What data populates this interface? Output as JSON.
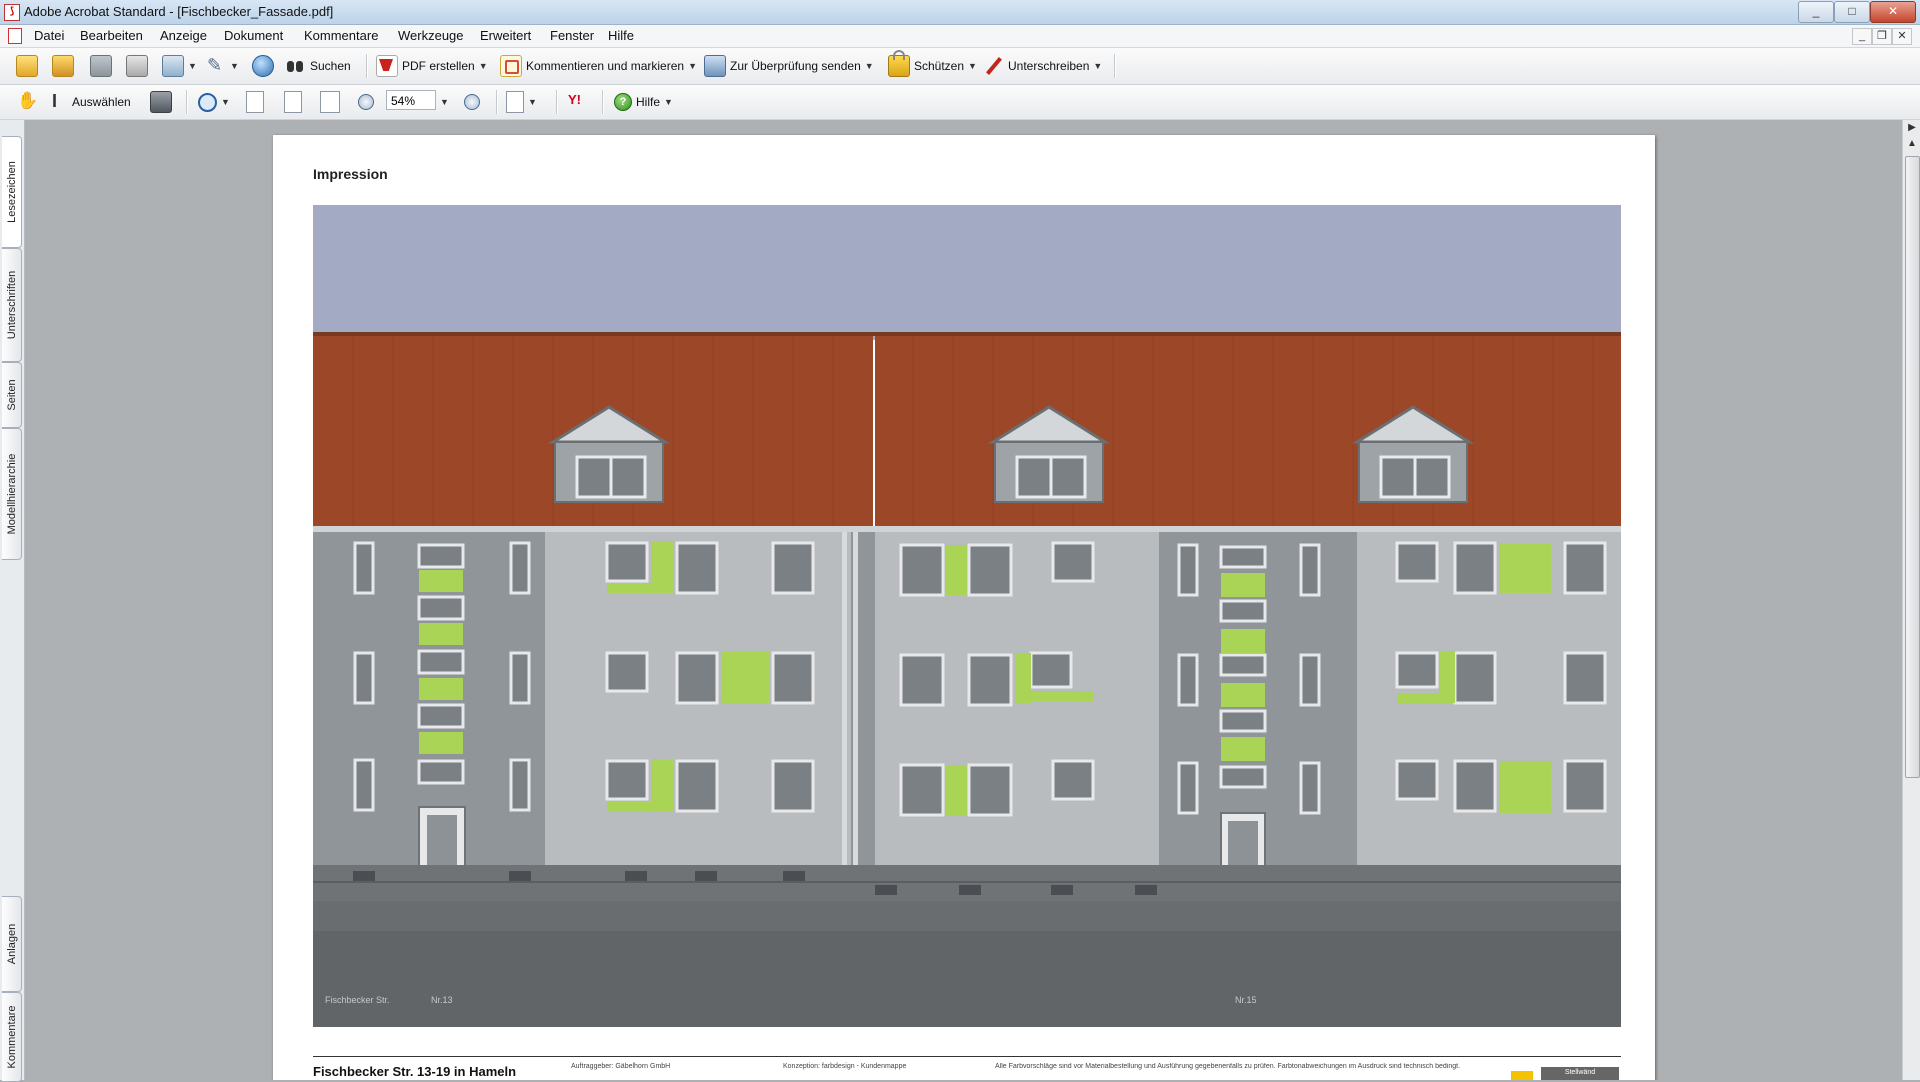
{
  "window": {
    "title": "Adobe Acrobat Standard - [Fischbecker_Fassade.pdf]",
    "controls": {
      "minimize": "_",
      "maximize": "□",
      "close": "✕"
    }
  },
  "menubar": {
    "items": [
      "Datei",
      "Bearbeiten",
      "Anzeige",
      "Dokument",
      "Kommentare",
      "Werkzeuge",
      "Erweitert",
      "Fenster",
      "Hilfe"
    ]
  },
  "toolbar1": {
    "find_label": "Suchen",
    "create_pdf_label": "PDF erstellen",
    "comment_label": "Kommentieren und markieren",
    "review_label": "Zur Überprüfung senden",
    "protect_label": "Schützen",
    "sign_label": "Unterschreiben"
  },
  "toolbar2": {
    "select_label": "Auswählen",
    "zoom_value": "54%",
    "help_label": "Hilfe"
  },
  "navpanel": {
    "tabs": [
      "Lesezeichen",
      "Unterschriften",
      "Seiten",
      "Modellhierarchie",
      "Anlagen",
      "Kommentare"
    ]
  },
  "document": {
    "heading": "Impression",
    "drawing_labels": {
      "street": "Fischbecker Str.",
      "nr13": "Nr.13",
      "nr15": "Nr.15"
    },
    "footer": {
      "title": "Fischbecker Str. 13-19 in Hameln",
      "client": "Auftraggeber: Gäbelhorn GmbH",
      "concept": "Konzeption: farbdesign - Kundenmappe",
      "note": "Alle Farbvorschläge sind vor Materialbestellung und Ausführung gegebenenfalls zu prüfen. Farbtonabweichungen im Ausdruck sind technisch bedingt.",
      "box": "Stellwänd"
    }
  },
  "colors": {
    "sky": "#a3abc4",
    "roof": "#9c4727",
    "facade_light": "#b9bcbf",
    "facade_dark": "#8f9598",
    "accent_green": "#a9d455",
    "window_glass": "#7b8085",
    "plinth": "#6f7376",
    "street": "#616568"
  }
}
